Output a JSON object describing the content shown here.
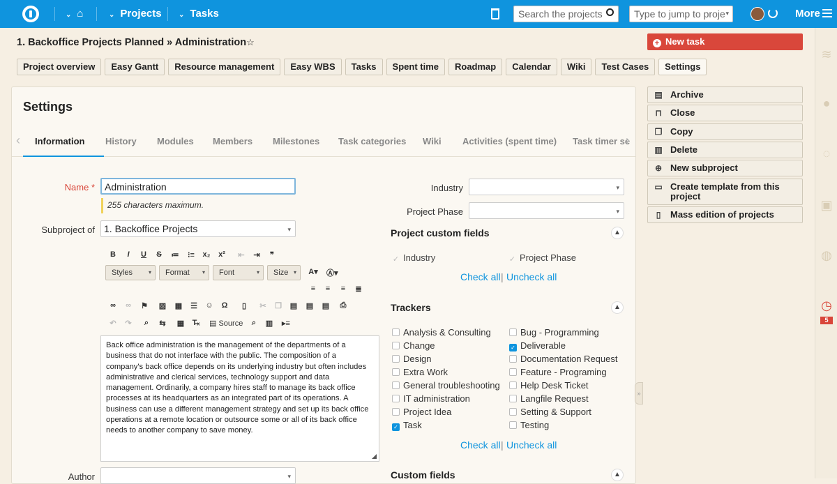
{
  "topbar": {
    "projects": "Projects",
    "tasks": "Tasks",
    "search_placeholder": "Search the projects",
    "jump_placeholder": "Type to jump to proje",
    "more": "More"
  },
  "breadcrumb": {
    "parent": "1. Backoffice Projects Planned",
    "separator": "»",
    "current": "Administration",
    "star": "☆"
  },
  "project_tabs": [
    "Project overview",
    "Easy Gantt",
    "Resource management",
    "Easy WBS",
    "Tasks",
    "Spent time",
    "Roadmap",
    "Calendar",
    "Wiki",
    "Test Cases",
    "Settings"
  ],
  "new_task": "New task",
  "settings": {
    "title": "Settings",
    "tabs": [
      "Information",
      "History",
      "Modules",
      "Members",
      "Milestones",
      "Task categories",
      "Wiki",
      "Activities (spent time)",
      "Task timer se"
    ]
  },
  "form": {
    "name_label": "Name",
    "required": "*",
    "name_value": "Administration",
    "name_hint": "255 characters maximum.",
    "subproject_label": "Subproject of",
    "subproject_value": "1. Backoffice Projects",
    "editor": {
      "styles": "Styles",
      "format": "Format",
      "font": "Font",
      "size": "Size",
      "source": "Source"
    },
    "description": "Back office administration is the management of the departments of a business that do not interface with the public. The composition of a company's back office depends on its underlying industry but often includes administrative and clerical services, technology support and data management. Ordinarily, a company hires staff to manage its back office processes at its headquarters as an integrated part of its operations. A business can use a different management strategy and set up its back office operations at a remote location or outsource some or all of its back office needs to another company to save money.",
    "author_label": "Author",
    "industry_label": "Industry",
    "phase_label": "Project Phase"
  },
  "custom_fields": {
    "title": "Project custom fields",
    "items": [
      "Industry",
      "Project Phase"
    ],
    "check_all": "Check all",
    "uncheck_all": "Uncheck all",
    "divider": "|"
  },
  "trackers": {
    "title": "Trackers",
    "left": [
      {
        "label": "Analysis & Consulting",
        "checked": false
      },
      {
        "label": "Change",
        "checked": false
      },
      {
        "label": "Design",
        "checked": false
      },
      {
        "label": "Extra Work",
        "checked": false
      },
      {
        "label": "General troubleshooting",
        "checked": false
      },
      {
        "label": "IT administration",
        "checked": false
      },
      {
        "label": "Project Idea",
        "checked": false
      },
      {
        "label": "Task",
        "checked": true
      }
    ],
    "right": [
      {
        "label": "Bug - Programming",
        "checked": false
      },
      {
        "label": "Deliverable",
        "checked": true
      },
      {
        "label": "Documentation Request",
        "checked": false
      },
      {
        "label": "Feature - Programing",
        "checked": false
      },
      {
        "label": "Help Desk Ticket",
        "checked": false
      },
      {
        "label": "Langfile Request",
        "checked": false
      },
      {
        "label": "Setting & Support",
        "checked": false
      },
      {
        "label": "Testing",
        "checked": false
      }
    ],
    "check_all": "Check all",
    "uncheck_all": "Uncheck all",
    "divider": "|"
  },
  "custom_fields_section": {
    "title": "Custom fields"
  },
  "sidebar_actions": [
    "Archive",
    "Close",
    "Copy",
    "Delete",
    "New subproject",
    "Create template from this project",
    "Mass edition of projects"
  ],
  "rail": {
    "badge": "5"
  },
  "colors": {
    "topbar": "#0f94de",
    "accent": "#d9473b",
    "link": "#0f94de"
  }
}
